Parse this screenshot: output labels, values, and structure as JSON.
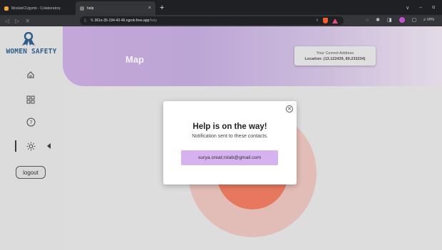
{
  "browser": {
    "tabs": [
      {
        "label": "ModuleCUgymb - Colaboratory"
      },
      {
        "label": "help"
      }
    ],
    "new_tab": "+",
    "window_controls": [
      "∨",
      "–",
      "ɑ"
    ],
    "address": {
      "host": "361e-35-194-43-46.ngrok-free.app",
      "path": "/help",
      "prefix": "% "
    },
    "vpn": "≡ VPN"
  },
  "sidebar": {
    "brand": "WOMEN SAFETY",
    "logout_label": "logout"
  },
  "header": {
    "title": "Map",
    "address_card": {
      "label": "Your Current Address",
      "location": "Location: (13.122429, 80.233234)"
    }
  },
  "modal": {
    "title": "Help is on the way!",
    "subtitle": "Notification sent to these contacts.",
    "contacts": [
      "surya.creat;rslab@gmail.com"
    ]
  },
  "colors": {
    "accent": "#d7b2f0",
    "header_start": "#c3a7d8",
    "brand": "#2f5d8a",
    "alert": "#e7785f"
  }
}
